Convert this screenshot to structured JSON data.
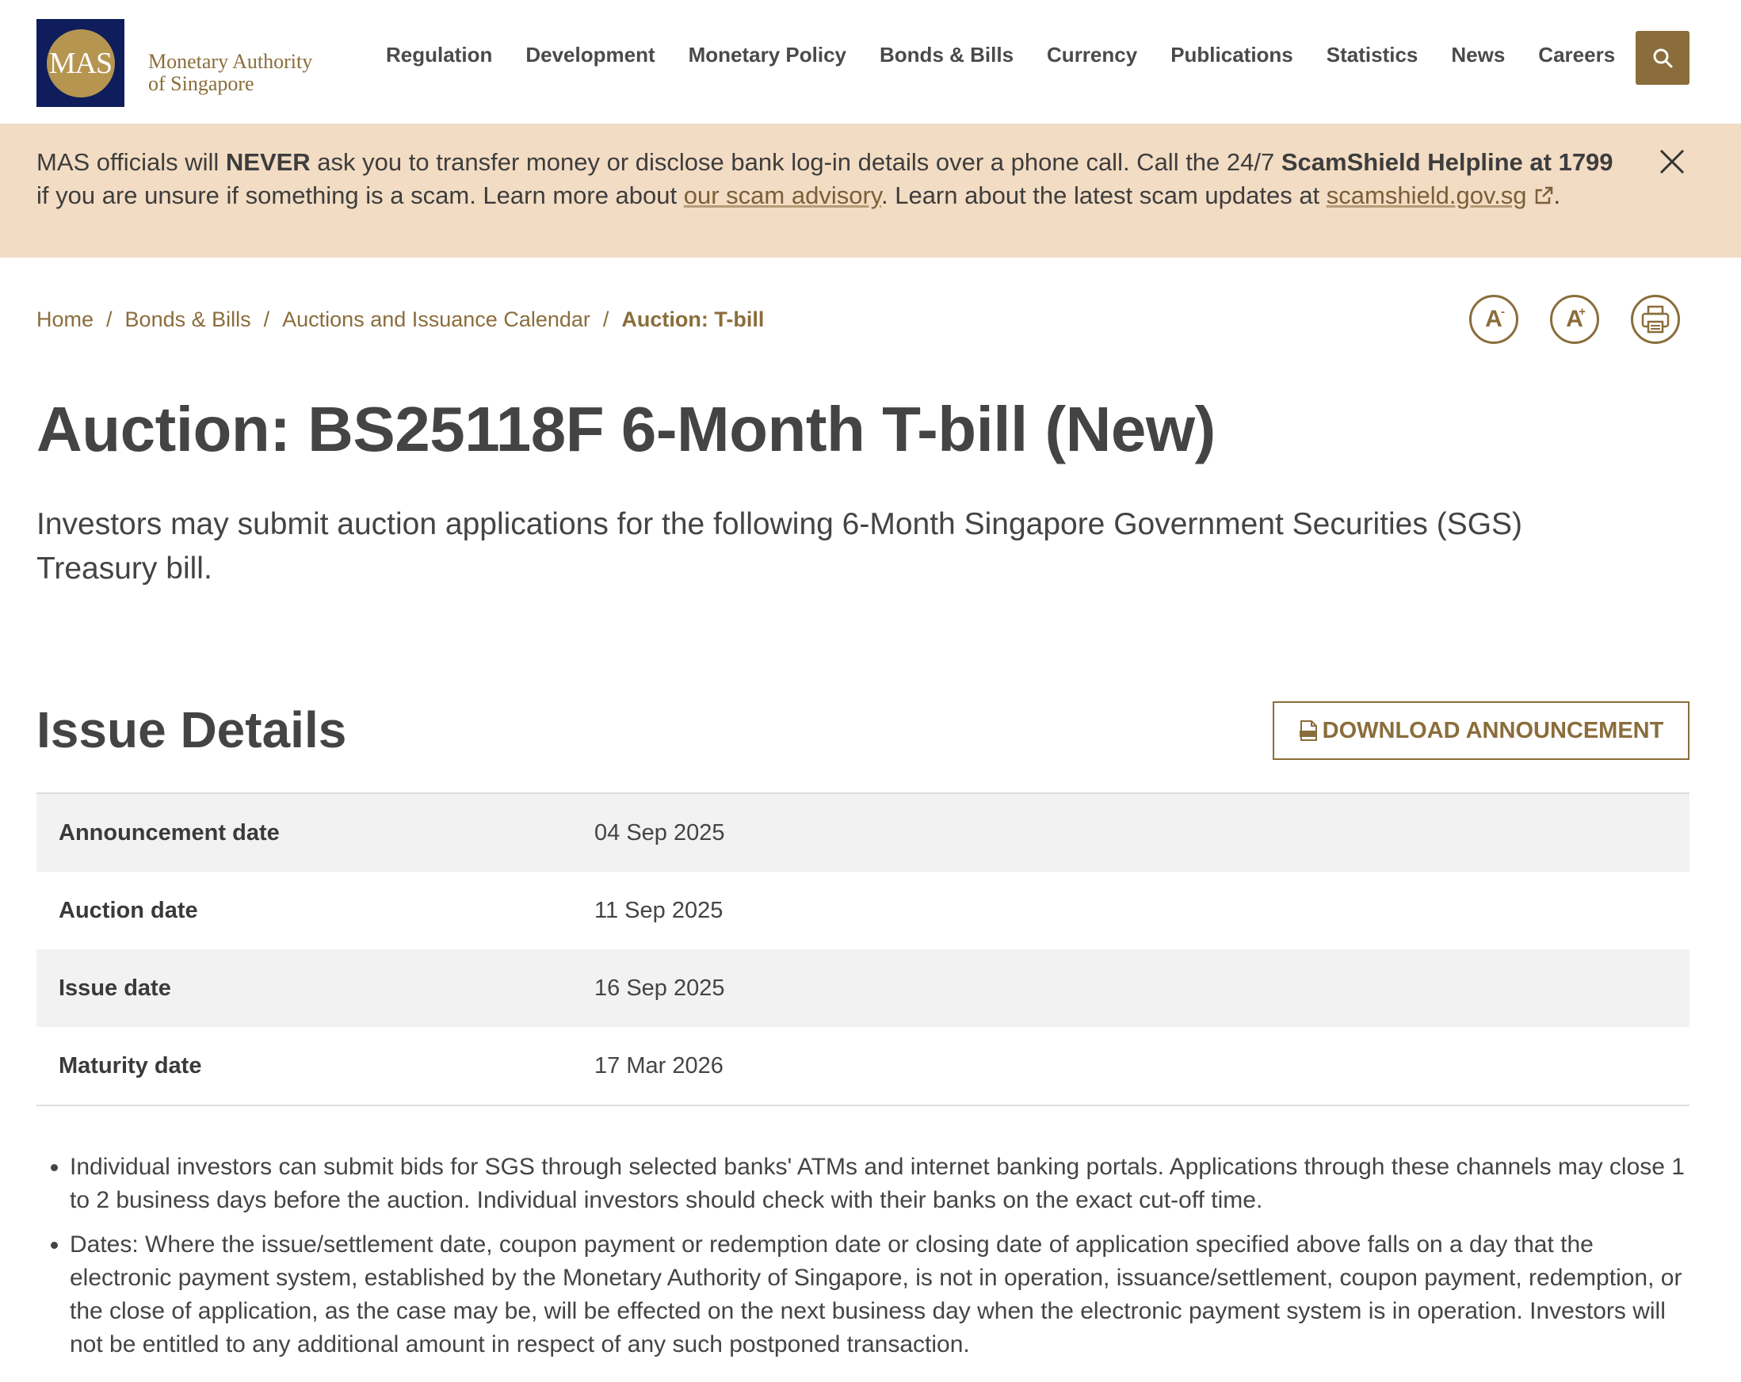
{
  "header": {
    "logo_mark": "MAS",
    "logo_line1": "Monetary Authority",
    "logo_line2": "of Singapore",
    "nav": [
      "Regulation",
      "Development",
      "Monetary Policy",
      "Bonds & Bills",
      "Currency",
      "Publications",
      "Statistics",
      "News",
      "Careers"
    ],
    "search_icon": "search-icon"
  },
  "banner": {
    "t1": "MAS officials will ",
    "b1": "NEVER",
    "t2": " ask you to transfer money or disclose bank log-in details over a phone call. Call the 24/7 ",
    "b2": "ScamShield Helpline at 1799",
    "t3": " if you are unsure if something is a scam. Learn more about ",
    "link1": "our scam advisory",
    "t4": ". Learn about the latest scam updates at ",
    "link2": "scamshield.gov.sg",
    "t5": ".",
    "close_icon": "close-icon",
    "external_icon": "external-link-icon"
  },
  "breadcrumb": {
    "items": [
      "Home",
      "Bonds & Bills",
      "Auctions and Issuance Calendar"
    ],
    "current": "Auction: T-bill",
    "separator": "/"
  },
  "tools": {
    "decrease": "A",
    "decrease_sup": "-",
    "increase": "A",
    "increase_sup": "+",
    "print_icon": "print-icon"
  },
  "page": {
    "title": "Auction: BS25118F 6-Month T-bill (New)",
    "lead": "Investors may submit auction applications for the following 6-Month Singapore Government Securities (SGS) Treasury bill."
  },
  "issue_details": {
    "title": "Issue Details",
    "download_label": "DOWNLOAD ANNOUNCEMENT",
    "rows": [
      {
        "label": "Announcement date",
        "value": "04 Sep 2025"
      },
      {
        "label": "Auction date",
        "value": "11 Sep 2025"
      },
      {
        "label": "Issue date",
        "value": "16 Sep 2025"
      },
      {
        "label": "Maturity date",
        "value": "17 Mar 2026"
      }
    ]
  },
  "notes": [
    "Individual investors can submit bids for SGS through selected banks' ATMs and internet banking portals. Applications through these channels may close 1 to 2 business days before the auction. Individual investors should check with their banks on the exact cut-off time.",
    "Dates: Where the issue/settlement date, coupon payment or redemption date or closing date of application specified above falls on a day that the electronic payment system, established by the Monetary Authority of Singapore, is not in operation, issuance/settlement, coupon payment, redemption, or the close of application, as the case may be, will be effected on the next business day when the electronic payment system is in operation. Investors will not be entitled to any additional amount in respect of any such postponed transaction."
  ],
  "colors": {
    "brand_gold": "#8a6d3b",
    "brand_navy": "#0f1d5c",
    "banner_bg": "#f2dcc3",
    "row_shade": "#f2f2f2"
  }
}
